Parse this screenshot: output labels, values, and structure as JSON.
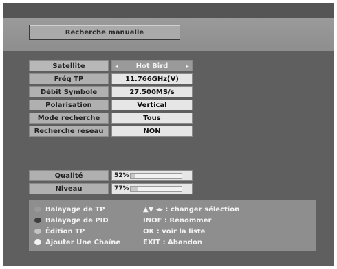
{
  "title": "Recherche manuelle",
  "params": [
    {
      "label": "Satellite",
      "value": "Hot Bird",
      "left_arrow": "◂",
      "right_arrow": "▸"
    },
    {
      "label": "Fréq TP",
      "value": "11.766GHz(V)"
    },
    {
      "label": "Débit Symbole",
      "value": "27.500MS/s"
    },
    {
      "label": "Polarisation",
      "value": "Vertical"
    },
    {
      "label": "Mode recherche",
      "value": "Tous"
    },
    {
      "label": "Recherche réseau",
      "value": "NON"
    }
  ],
  "signal": {
    "quality": {
      "label": "Qualité",
      "value": "52%",
      "level": 0.1
    },
    "level": {
      "label": "Niveau",
      "value": "77%",
      "level": 0.15
    }
  },
  "legend": [
    {
      "label": "Balayage de TP",
      "color": "#9a9a9a"
    },
    {
      "label": "Balayage de PID",
      "color": "#3e3e3e"
    },
    {
      "label": "Édition TP",
      "color": "#c4c4c4"
    },
    {
      "label": "Ajouter Une Chaîne",
      "color": "#f4f4f4"
    }
  ],
  "keys": [
    "▲▼ ◂▸ : changer sélection",
    "INOF : Renommer",
    "OK : voir la liste",
    "EXIT : Abandon"
  ]
}
